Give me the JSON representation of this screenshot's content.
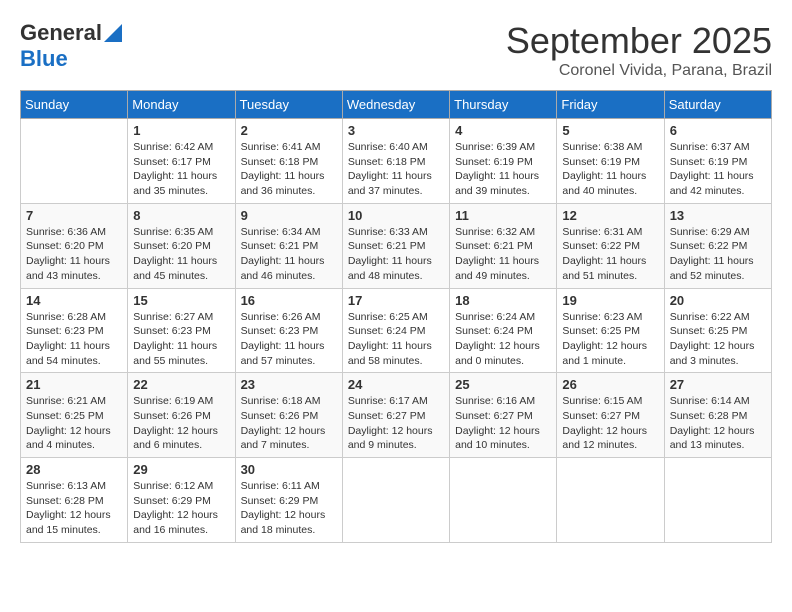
{
  "header": {
    "logo_general": "General",
    "logo_blue": "Blue",
    "month_title": "September 2025",
    "subtitle": "Coronel Vivida, Parana, Brazil"
  },
  "weekdays": [
    "Sunday",
    "Monday",
    "Tuesday",
    "Wednesday",
    "Thursday",
    "Friday",
    "Saturday"
  ],
  "weeks": [
    [
      {
        "day": "",
        "sunrise": "",
        "sunset": "",
        "daylight": ""
      },
      {
        "day": "1",
        "sunrise": "Sunrise: 6:42 AM",
        "sunset": "Sunset: 6:17 PM",
        "daylight": "Daylight: 11 hours and 35 minutes."
      },
      {
        "day": "2",
        "sunrise": "Sunrise: 6:41 AM",
        "sunset": "Sunset: 6:18 PM",
        "daylight": "Daylight: 11 hours and 36 minutes."
      },
      {
        "day": "3",
        "sunrise": "Sunrise: 6:40 AM",
        "sunset": "Sunset: 6:18 PM",
        "daylight": "Daylight: 11 hours and 37 minutes."
      },
      {
        "day": "4",
        "sunrise": "Sunrise: 6:39 AM",
        "sunset": "Sunset: 6:19 PM",
        "daylight": "Daylight: 11 hours and 39 minutes."
      },
      {
        "day": "5",
        "sunrise": "Sunrise: 6:38 AM",
        "sunset": "Sunset: 6:19 PM",
        "daylight": "Daylight: 11 hours and 40 minutes."
      },
      {
        "day": "6",
        "sunrise": "Sunrise: 6:37 AM",
        "sunset": "Sunset: 6:19 PM",
        "daylight": "Daylight: 11 hours and 42 minutes."
      }
    ],
    [
      {
        "day": "7",
        "sunrise": "Sunrise: 6:36 AM",
        "sunset": "Sunset: 6:20 PM",
        "daylight": "Daylight: 11 hours and 43 minutes."
      },
      {
        "day": "8",
        "sunrise": "Sunrise: 6:35 AM",
        "sunset": "Sunset: 6:20 PM",
        "daylight": "Daylight: 11 hours and 45 minutes."
      },
      {
        "day": "9",
        "sunrise": "Sunrise: 6:34 AM",
        "sunset": "Sunset: 6:21 PM",
        "daylight": "Daylight: 11 hours and 46 minutes."
      },
      {
        "day": "10",
        "sunrise": "Sunrise: 6:33 AM",
        "sunset": "Sunset: 6:21 PM",
        "daylight": "Daylight: 11 hours and 48 minutes."
      },
      {
        "day": "11",
        "sunrise": "Sunrise: 6:32 AM",
        "sunset": "Sunset: 6:21 PM",
        "daylight": "Daylight: 11 hours and 49 minutes."
      },
      {
        "day": "12",
        "sunrise": "Sunrise: 6:31 AM",
        "sunset": "Sunset: 6:22 PM",
        "daylight": "Daylight: 11 hours and 51 minutes."
      },
      {
        "day": "13",
        "sunrise": "Sunrise: 6:29 AM",
        "sunset": "Sunset: 6:22 PM",
        "daylight": "Daylight: 11 hours and 52 minutes."
      }
    ],
    [
      {
        "day": "14",
        "sunrise": "Sunrise: 6:28 AM",
        "sunset": "Sunset: 6:23 PM",
        "daylight": "Daylight: 11 hours and 54 minutes."
      },
      {
        "day": "15",
        "sunrise": "Sunrise: 6:27 AM",
        "sunset": "Sunset: 6:23 PM",
        "daylight": "Daylight: 11 hours and 55 minutes."
      },
      {
        "day": "16",
        "sunrise": "Sunrise: 6:26 AM",
        "sunset": "Sunset: 6:23 PM",
        "daylight": "Daylight: 11 hours and 57 minutes."
      },
      {
        "day": "17",
        "sunrise": "Sunrise: 6:25 AM",
        "sunset": "Sunset: 6:24 PM",
        "daylight": "Daylight: 11 hours and 58 minutes."
      },
      {
        "day": "18",
        "sunrise": "Sunrise: 6:24 AM",
        "sunset": "Sunset: 6:24 PM",
        "daylight": "Daylight: 12 hours and 0 minutes."
      },
      {
        "day": "19",
        "sunrise": "Sunrise: 6:23 AM",
        "sunset": "Sunset: 6:25 PM",
        "daylight": "Daylight: 12 hours and 1 minute."
      },
      {
        "day": "20",
        "sunrise": "Sunrise: 6:22 AM",
        "sunset": "Sunset: 6:25 PM",
        "daylight": "Daylight: 12 hours and 3 minutes."
      }
    ],
    [
      {
        "day": "21",
        "sunrise": "Sunrise: 6:21 AM",
        "sunset": "Sunset: 6:25 PM",
        "daylight": "Daylight: 12 hours and 4 minutes."
      },
      {
        "day": "22",
        "sunrise": "Sunrise: 6:19 AM",
        "sunset": "Sunset: 6:26 PM",
        "daylight": "Daylight: 12 hours and 6 minutes."
      },
      {
        "day": "23",
        "sunrise": "Sunrise: 6:18 AM",
        "sunset": "Sunset: 6:26 PM",
        "daylight": "Daylight: 12 hours and 7 minutes."
      },
      {
        "day": "24",
        "sunrise": "Sunrise: 6:17 AM",
        "sunset": "Sunset: 6:27 PM",
        "daylight": "Daylight: 12 hours and 9 minutes."
      },
      {
        "day": "25",
        "sunrise": "Sunrise: 6:16 AM",
        "sunset": "Sunset: 6:27 PM",
        "daylight": "Daylight: 12 hours and 10 minutes."
      },
      {
        "day": "26",
        "sunrise": "Sunrise: 6:15 AM",
        "sunset": "Sunset: 6:27 PM",
        "daylight": "Daylight: 12 hours and 12 minutes."
      },
      {
        "day": "27",
        "sunrise": "Sunrise: 6:14 AM",
        "sunset": "Sunset: 6:28 PM",
        "daylight": "Daylight: 12 hours and 13 minutes."
      }
    ],
    [
      {
        "day": "28",
        "sunrise": "Sunrise: 6:13 AM",
        "sunset": "Sunset: 6:28 PM",
        "daylight": "Daylight: 12 hours and 15 minutes."
      },
      {
        "day": "29",
        "sunrise": "Sunrise: 6:12 AM",
        "sunset": "Sunset: 6:29 PM",
        "daylight": "Daylight: 12 hours and 16 minutes."
      },
      {
        "day": "30",
        "sunrise": "Sunrise: 6:11 AM",
        "sunset": "Sunset: 6:29 PM",
        "daylight": "Daylight: 12 hours and 18 minutes."
      },
      {
        "day": "",
        "sunrise": "",
        "sunset": "",
        "daylight": ""
      },
      {
        "day": "",
        "sunrise": "",
        "sunset": "",
        "daylight": ""
      },
      {
        "day": "",
        "sunrise": "",
        "sunset": "",
        "daylight": ""
      },
      {
        "day": "",
        "sunrise": "",
        "sunset": "",
        "daylight": ""
      }
    ]
  ]
}
